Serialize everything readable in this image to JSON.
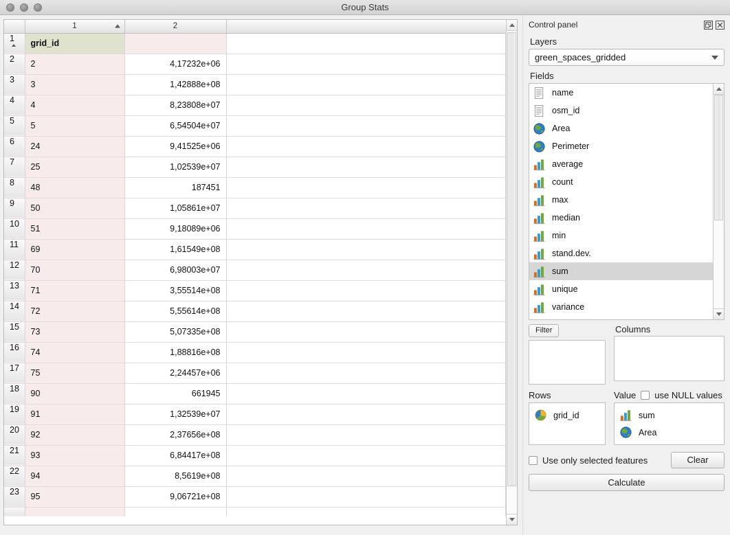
{
  "window": {
    "title": "Group Stats",
    "traffic_lights": [
      "close-button",
      "minimize-button",
      "zoom-button"
    ]
  },
  "table": {
    "columns": [
      "1",
      "2"
    ],
    "sort_column": "1",
    "sort_direction": "ascending",
    "header_row": {
      "index": "1",
      "col1": "grid_id",
      "col2": ""
    },
    "rows": [
      {
        "index": "2",
        "col1": "2",
        "col2": "4,17232e+06"
      },
      {
        "index": "3",
        "col1": "3",
        "col2": "1,42888e+08"
      },
      {
        "index": "4",
        "col1": "4",
        "col2": "8,23808e+07"
      },
      {
        "index": "5",
        "col1": "5",
        "col2": "6,54504e+07"
      },
      {
        "index": "6",
        "col1": "24",
        "col2": "9,41525e+06"
      },
      {
        "index": "7",
        "col1": "25",
        "col2": "1,02539e+07"
      },
      {
        "index": "8",
        "col1": "48",
        "col2": "187451"
      },
      {
        "index": "9",
        "col1": "50",
        "col2": "1,05861e+07"
      },
      {
        "index": "10",
        "col1": "51",
        "col2": "9,18089e+06"
      },
      {
        "index": "11",
        "col1": "69",
        "col2": "1,61549e+08"
      },
      {
        "index": "12",
        "col1": "70",
        "col2": "6,98003e+07"
      },
      {
        "index": "13",
        "col1": "71",
        "col2": "3,55514e+08"
      },
      {
        "index": "14",
        "col1": "72",
        "col2": "5,55614e+08"
      },
      {
        "index": "15",
        "col1": "73",
        "col2": "5,07335e+08"
      },
      {
        "index": "16",
        "col1": "74",
        "col2": "1,88816e+08"
      },
      {
        "index": "17",
        "col1": "75",
        "col2": "2,24457e+06"
      },
      {
        "index": "18",
        "col1": "90",
        "col2": "661945"
      },
      {
        "index": "19",
        "col1": "91",
        "col2": "1,32539e+07"
      },
      {
        "index": "20",
        "col1": "92",
        "col2": "2,37656e+08"
      },
      {
        "index": "21",
        "col1": "93",
        "col2": "6,84417e+08"
      },
      {
        "index": "22",
        "col1": "94",
        "col2": "8,5619e+08"
      },
      {
        "index": "23",
        "col1": "95",
        "col2": "9,06721e+08"
      }
    ]
  },
  "control_panel": {
    "title": "Control panel",
    "float_icon": "float-icon",
    "close_icon": "close-icon",
    "layers": {
      "label": "Layers",
      "selected": "green_spaces_gridded"
    },
    "fields": {
      "label": "Fields",
      "items": [
        {
          "label": "name",
          "icon": "text-field-icon"
        },
        {
          "label": "osm_id",
          "icon": "text-field-icon"
        },
        {
          "label": "Area",
          "icon": "geometry-icon"
        },
        {
          "label": "Perimeter",
          "icon": "geometry-icon"
        },
        {
          "label": "average",
          "icon": "statistic-icon"
        },
        {
          "label": "count",
          "icon": "statistic-icon"
        },
        {
          "label": "max",
          "icon": "statistic-icon"
        },
        {
          "label": "median",
          "icon": "statistic-icon"
        },
        {
          "label": "min",
          "icon": "statistic-icon"
        },
        {
          "label": "stand.dev.",
          "icon": "statistic-icon"
        },
        {
          "label": "sum",
          "icon": "statistic-icon",
          "selected": true
        },
        {
          "label": "unique",
          "icon": "statistic-icon"
        },
        {
          "label": "variance",
          "icon": "statistic-icon"
        }
      ]
    },
    "filter": {
      "label": "Filter",
      "items": []
    },
    "columns": {
      "label": "Columns",
      "items": []
    },
    "rows": {
      "label": "Rows",
      "items": [
        {
          "label": "grid_id",
          "icon": "pie-field-icon"
        }
      ]
    },
    "value": {
      "label": "Value",
      "use_null_label": "use NULL values",
      "use_null_checked": false,
      "items": [
        {
          "label": "sum",
          "icon": "statistic-icon"
        },
        {
          "label": "Area",
          "icon": "geometry-icon"
        }
      ]
    },
    "use_only_selected": {
      "label": "Use only selected features",
      "checked": false
    },
    "clear_button": "Clear",
    "calculate_button": "Calculate"
  },
  "colors": {
    "header_cell_green": "#dfe2cd",
    "row_pink": "#f7eceb",
    "selection_gray": "#d6d6d6",
    "window_chrome": "#f0f0f0"
  }
}
